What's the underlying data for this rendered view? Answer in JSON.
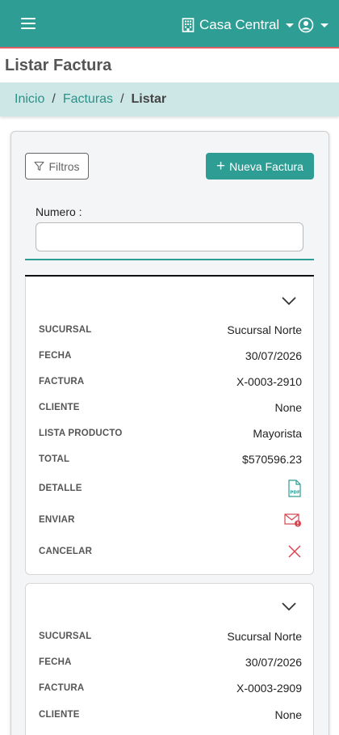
{
  "header": {
    "branch": "Casa Central"
  },
  "page": {
    "title": "Listar Factura"
  },
  "breadcrumb": {
    "items": [
      "Inicio",
      "Facturas",
      "Listar"
    ],
    "separator": "/"
  },
  "toolbar": {
    "filters_label": "Filtros",
    "new_label": "Nueva Factura",
    "new_icon": "+"
  },
  "search": {
    "label": "Numero :",
    "value": ""
  },
  "labels": {
    "sucursal": "SUCURSAL",
    "fecha": "FECHA",
    "factura": "FACTURA",
    "cliente": "CLIENTE",
    "lista_producto": "LISTA PRODUCTO",
    "total": "TOTAL",
    "detalle": "DETALLE",
    "enviar": "ENVIAR",
    "cancelar": "CANCELAR"
  },
  "invoices": [
    {
      "sucursal": "Sucursal Norte",
      "fecha": "30/07/2026",
      "factura": "X-0003-2910",
      "cliente": "None",
      "lista_producto": "Mayorista",
      "total": "$570596.23"
    },
    {
      "sucursal": "Sucursal Norte",
      "fecha": "30/07/2026",
      "factura": "X-0003-2909",
      "cliente": "None"
    }
  ],
  "colors": {
    "primary": "#2e9e95",
    "breadcrumb_bg": "#cde7e6",
    "danger": "#d9434f",
    "accent_line": "#e0606a"
  },
  "icons": {
    "menu": "hamburger-icon",
    "branch": "building-icon",
    "user": "user-circle-icon",
    "filter": "filter-icon",
    "detail": "pdf-icon",
    "send": "envelope-alert-icon",
    "cancel": "close-icon",
    "expand": "chevron-down-icon"
  }
}
